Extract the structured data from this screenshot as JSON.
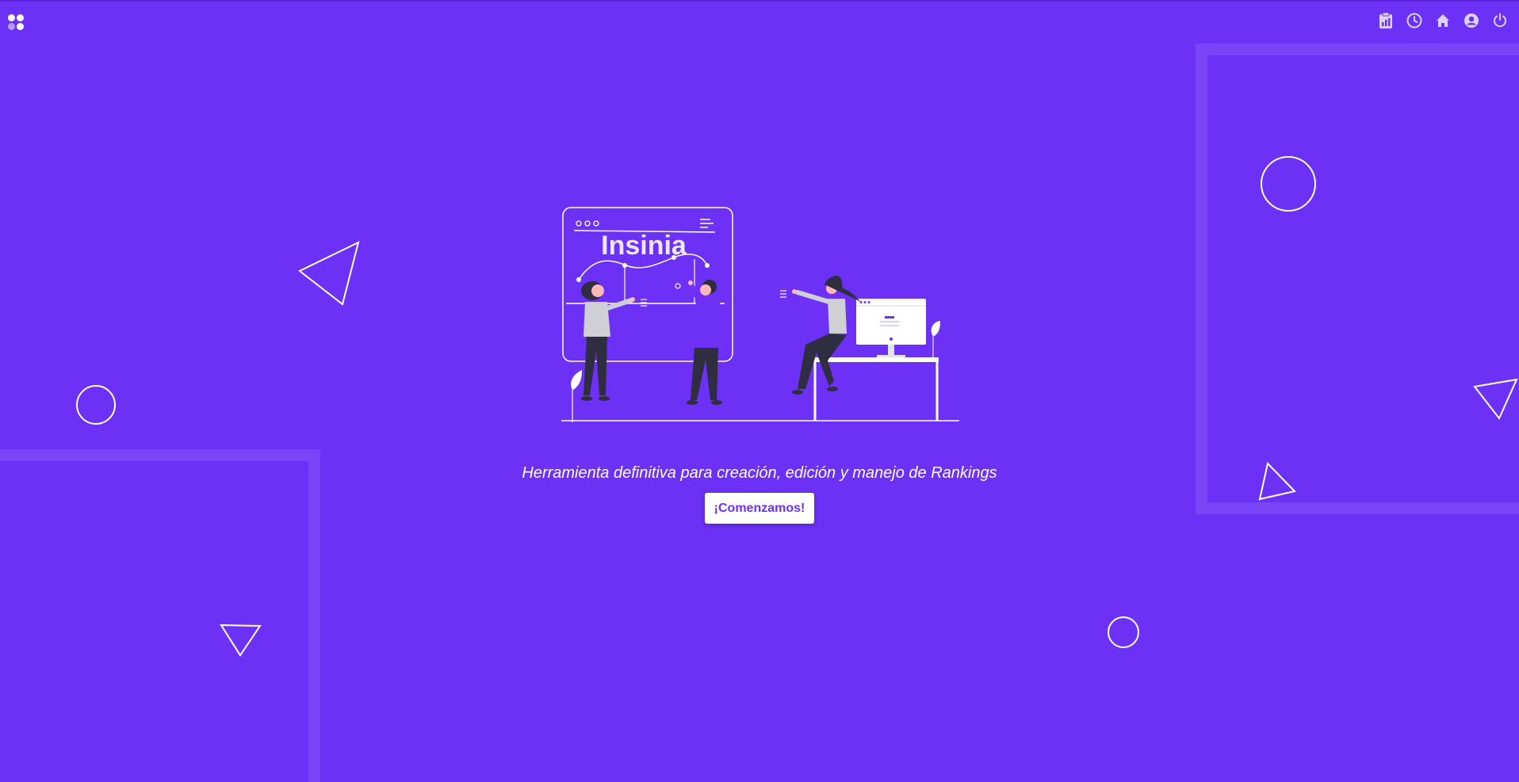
{
  "header": {
    "logo_icon": "app-grid-logo",
    "nav_icons": [
      "clipboard-chart-icon",
      "clock-icon",
      "home-icon",
      "user-circle-icon",
      "power-icon"
    ]
  },
  "hero": {
    "illustration_title": "Insinia",
    "tagline": "Herramienta definitiva para creación, edición y manejo de Rankings",
    "cta_label": "¡Comenzamos!"
  },
  "colors": {
    "background": "#6c31f5",
    "panel_border": "#7a45f6",
    "button_bg": "#ffffff",
    "button_text": "#6c31f5"
  }
}
